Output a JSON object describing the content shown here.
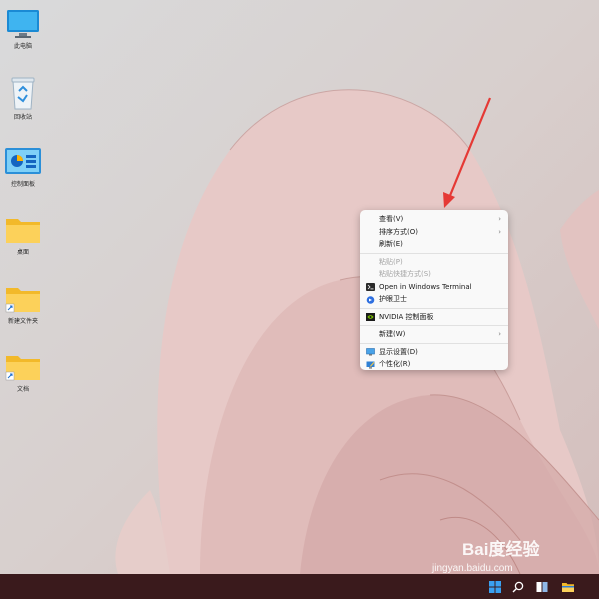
{
  "desktop": {
    "icons": [
      {
        "label": "此电脑",
        "icon": "monitor-icon"
      },
      {
        "label": "回收站",
        "icon": "recycle-bin-icon"
      },
      {
        "label": "控制面板",
        "icon": "control-panel-icon"
      },
      {
        "label": "桌面",
        "icon": "folder-icon"
      },
      {
        "label": "新建文件夹",
        "icon": "folder-shortcut-icon"
      },
      {
        "label": "文档",
        "icon": "folder-shortcut-icon"
      }
    ]
  },
  "context_menu": {
    "items": [
      {
        "label": "查看(V)",
        "submenu": true,
        "enabled": true
      },
      {
        "label": "排序方式(O)",
        "submenu": true,
        "enabled": true
      },
      {
        "label": "刷新(E)",
        "enabled": true
      },
      {
        "label": "粘贴(P)",
        "enabled": false
      },
      {
        "label": "粘贴快捷方式(S)",
        "enabled": false
      },
      {
        "label": "Open in Windows Terminal",
        "icon": "terminal-icon",
        "enabled": true
      },
      {
        "label": "护眼卫士",
        "icon": "eye-guard-icon",
        "enabled": true
      },
      {
        "label": "NVIDIA 控制面板",
        "icon": "nvidia-icon",
        "enabled": true
      },
      {
        "label": "新建(W)",
        "submenu": true,
        "enabled": true
      },
      {
        "label": "显示设置(D)",
        "icon": "display-settings-icon",
        "enabled": true
      },
      {
        "label": "个性化(R)",
        "icon": "personalize-icon",
        "enabled": true
      }
    ]
  },
  "watermark": {
    "brand": "Bai度经验",
    "site": "jingyan.baidu.com"
  },
  "colors": {
    "taskbar": "#3a1a1c",
    "menu_bg": "#f9f9f9",
    "arrow": "#e53935"
  }
}
